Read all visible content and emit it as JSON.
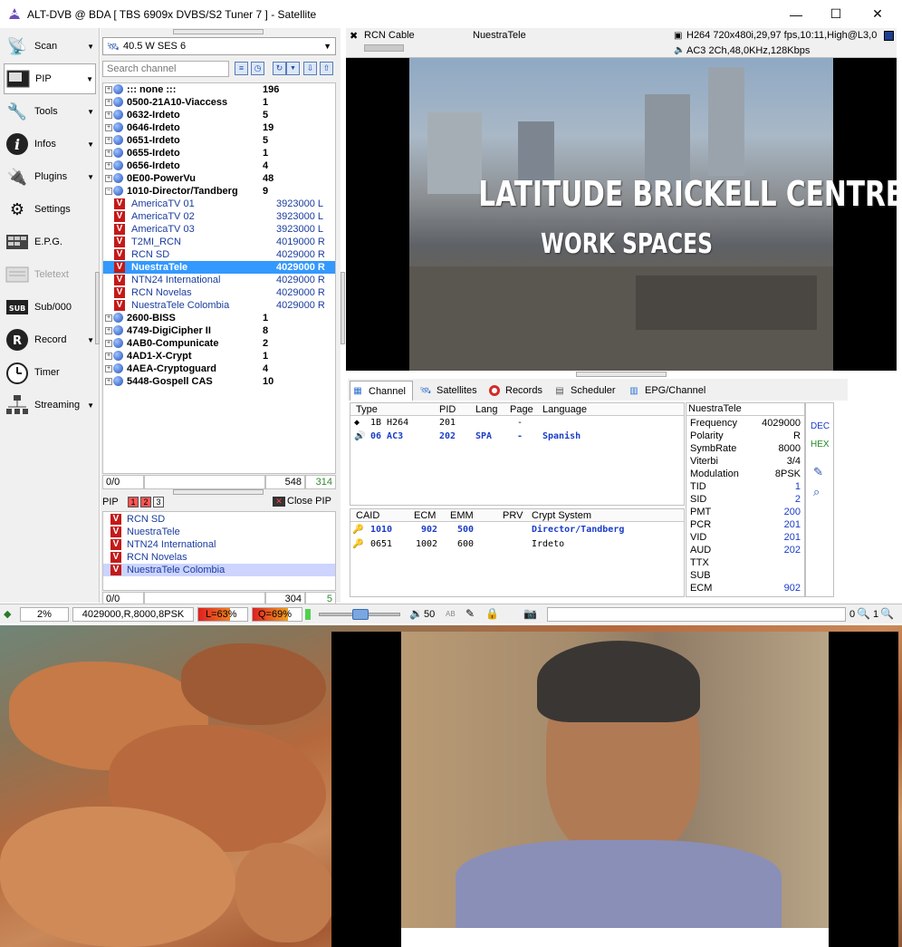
{
  "window": {
    "title": "ALT-DVB @ BDA [ TBS 6909x DVBS/S2 Tuner 7 ] - Satellite",
    "minimize": "—",
    "maximize": "☐",
    "close": "✕"
  },
  "menu": [
    {
      "label": "Scan",
      "icon": "scan-icon",
      "arrow": true
    },
    {
      "label": "PIP",
      "icon": "pip-icon",
      "arrow": true,
      "selected": true
    },
    {
      "label": "Tools",
      "icon": "tools-icon",
      "arrow": true
    },
    {
      "label": "Infos",
      "icon": "info-icon",
      "arrow": true
    },
    {
      "label": "Plugins",
      "icon": "plugins-icon",
      "arrow": true
    },
    {
      "label": "Settings",
      "icon": "settings-icon",
      "arrow": false
    },
    {
      "label": "E.P.G.",
      "icon": "epg-icon",
      "arrow": false
    },
    {
      "label": "Teletext",
      "icon": "teletext-icon",
      "arrow": false,
      "disabled": true
    },
    {
      "label": "Sub/000",
      "icon": "subtitle-icon",
      "arrow": false
    },
    {
      "label": "Record",
      "icon": "record-icon",
      "arrow": true
    },
    {
      "label": "Timer",
      "icon": "timer-icon",
      "arrow": false
    },
    {
      "label": "Streaming",
      "icon": "streaming-icon",
      "arrow": true
    }
  ],
  "satellite": {
    "selected": "40.5 W SES 6"
  },
  "search": {
    "placeholder": "Search channel"
  },
  "tree": {
    "groups_top": [
      {
        "name": "::: none :::",
        "count": "196"
      },
      {
        "name": "0500-21A10-Viaccess",
        "count": "1"
      },
      {
        "name": "0632-Irdeto",
        "count": "5"
      },
      {
        "name": "0646-Irdeto",
        "count": "19"
      },
      {
        "name": "0651-Irdeto",
        "count": "5"
      },
      {
        "name": "0655-Irdeto",
        "count": "1"
      },
      {
        "name": "0656-Irdeto",
        "count": "4"
      },
      {
        "name": "0E00-PowerVu",
        "count": "48"
      },
      {
        "name": "1010-Director/Tandberg",
        "count": "9",
        "expanded": true
      }
    ],
    "channels": [
      {
        "name": "AmericaTV 01",
        "freq": "3923000 L"
      },
      {
        "name": "AmericaTV 02",
        "freq": "3923000 L"
      },
      {
        "name": "AmericaTV 03",
        "freq": "3923000 L"
      },
      {
        "name": "T2MI_RCN",
        "freq": "4019000 R"
      },
      {
        "name": "RCN SD",
        "freq": "4029000 R"
      },
      {
        "name": "NuestraTele",
        "freq": "4029000 R",
        "selected": true
      },
      {
        "name": "NTN24 International",
        "freq": "4029000 R"
      },
      {
        "name": "RCN Novelas",
        "freq": "4029000 R"
      },
      {
        "name": "NuestraTele Colombia",
        "freq": "4029000 R"
      }
    ],
    "groups_bottom": [
      {
        "name": "2600-BISS",
        "count": "1"
      },
      {
        "name": "4749-DigiCipher II",
        "count": "8"
      },
      {
        "name": "4AB0-Compunicate",
        "count": "2"
      },
      {
        "name": "4AD1-X-Crypt",
        "count": "1"
      },
      {
        "name": "4AEA-Cryptoguard",
        "count": "4"
      },
      {
        "name": "5448-Gospell CAS",
        "count": "10"
      }
    ],
    "status": {
      "pos": "0/0",
      "total": "548",
      "extra": "314"
    }
  },
  "pip": {
    "label": "PIP",
    "buttons": [
      "1",
      "2",
      "3"
    ],
    "close_label": "Close PIP",
    "channels": [
      "RCN SD",
      "NuestraTele",
      "NTN24 International",
      "RCN Novelas",
      "NuestraTele Colombia"
    ],
    "status": {
      "pos": "0/0",
      "total": "304",
      "extra": "5"
    }
  },
  "infobar": {
    "provider": "RCN Cable",
    "channel": "NuestraTele",
    "video": "H264 720x480i,29,97 fps,10:11,High@L3,0",
    "audio": "AC3 2Ch,48,0KHz,128Kbps"
  },
  "video_overlay": {
    "line1": "LATITUDE BRICKELL CENTRE",
    "line2": "WORK SPACES"
  },
  "tabs": [
    {
      "label": "Channel",
      "icon": "channel-icon",
      "selected": true
    },
    {
      "label": "Satellites",
      "icon": "satellite-icon"
    },
    {
      "label": "Records",
      "icon": "record-icon"
    },
    {
      "label": "Scheduler",
      "icon": "scheduler-icon"
    },
    {
      "label": "EPG/Channel",
      "icon": "epg-icon"
    }
  ],
  "pid_table": {
    "headers": [
      "Type",
      "PID",
      "Lang",
      "Page",
      "Language"
    ],
    "rows": [
      {
        "type": "1B H264",
        "pid": "201",
        "lang": "",
        "page": "-",
        "language": ""
      },
      {
        "type": "06 AC3",
        "pid": "202",
        "lang": "SPA",
        "page": "-",
        "language": "Spanish"
      }
    ]
  },
  "crypt_table": {
    "headers": [
      "CAID",
      "ECM",
      "EMM",
      "PRV",
      "Crypt System"
    ],
    "rows": [
      {
        "caid": "1010",
        "ecm": "902",
        "emm": "500",
        "prv": "",
        "system": "Director/Tandberg"
      },
      {
        "caid": "0651",
        "ecm": "1002",
        "emm": "600",
        "prv": "",
        "system": "Irdeto"
      }
    ]
  },
  "channel_info": {
    "title": "NuestraTele",
    "rows": [
      {
        "k": "Frequency",
        "v": "4029000"
      },
      {
        "k": "Polarity",
        "v": "R"
      },
      {
        "k": "SymbRate",
        "v": "8000"
      },
      {
        "k": "Viterbi",
        "v": "3/4"
      },
      {
        "k": "Modulation",
        "v": "8PSK"
      },
      {
        "k": "TID",
        "v": "1"
      },
      {
        "k": "SID",
        "v": "2"
      },
      {
        "k": "PMT",
        "v": "200"
      },
      {
        "k": "PCR",
        "v": "201"
      },
      {
        "k": "VID",
        "v": "201"
      },
      {
        "k": "AUD",
        "v": "202"
      },
      {
        "k": "TTX",
        "v": ""
      },
      {
        "k": "SUB",
        "v": ""
      },
      {
        "k": "ECM",
        "v": "902"
      }
    ],
    "dec": "DEC",
    "hex": "HEX"
  },
  "statusbar": {
    "percent": "2%",
    "tuning": "4029000,R,8000,8PSK",
    "level": "L=63%",
    "quality": "Q=69%",
    "level_value": 63,
    "quality_value": 69,
    "volume_value": 50,
    "volume": "50",
    "ab": "AB",
    "counter": "0",
    "counter2": "1"
  },
  "colors": {
    "accent": "#3399ff",
    "channel_text": "#1a3c9e",
    "badge": "#c41919"
  }
}
